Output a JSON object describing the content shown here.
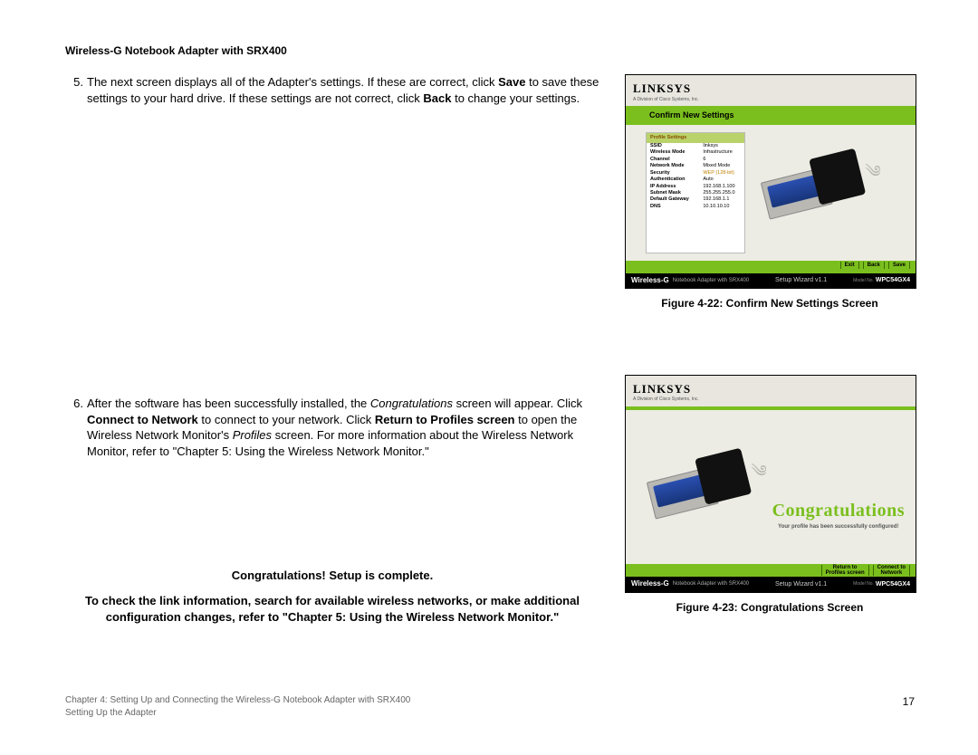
{
  "header": "Wireless-G Notebook Adapter with SRX400",
  "steps": {
    "s5": {
      "num": "5.",
      "pre": "The next screen displays all of the Adapter's settings. If these are correct, click ",
      "b1": "Save",
      "mid": " to save these settings to your hard drive. If these settings are not correct, click ",
      "b2": "Back",
      "post": " to change your settings."
    },
    "s6": {
      "num": "6.",
      "pre": "After the software has been successfully installed, the ",
      "i1": "Congratulations",
      "m1": " screen will appear. Click ",
      "b1": "Connect to Network",
      "m2": " to connect to your network. Click ",
      "b2": "Return to Profiles screen",
      "m3": " to open the Wireless Network Monitor's ",
      "i2": "Profiles",
      "m4": " screen. For more information about the Wireless Network Monitor, refer to \"Chapter 5: Using the Wireless Network Monitor.\""
    }
  },
  "congrats_block": {
    "line1": "Congratulations! Setup is complete.",
    "line2": "To check the link information, search for available wireless networks, or make additional configuration changes, refer to \"Chapter 5: Using the Wireless Network Monitor.\""
  },
  "figure1": {
    "logo": "LINKSYS",
    "logo_sub": "A Division of Cisco Systems, Inc.",
    "band": "Confirm New Settings",
    "ps_head": "Profile Settings",
    "rows": [
      [
        "SSID",
        "linksys"
      ],
      [
        "Wireless Mode",
        "Infrastructure"
      ],
      [
        "Channel",
        "6"
      ],
      [
        "Network Mode",
        "Mixed Mode"
      ],
      [
        "Security",
        "WEP (128-bit)"
      ],
      [
        "Authentication",
        "Auto"
      ],
      [
        "IP Address",
        "192.168.1.100"
      ],
      [
        "Subnet Mask",
        "255.255.255.0"
      ],
      [
        "Default Gateway",
        "192.168.1.1"
      ],
      [
        "DNS",
        "10.10.10.10"
      ]
    ],
    "btns": [
      "Exit",
      "Back",
      "Save"
    ],
    "bar_wg": "Wireless-G",
    "bar_desc": "Notebook Adapter with SRX400",
    "bar_mid": "Setup Wizard  v1.1",
    "bar_model_l": "Model No.",
    "bar_model": "WPC54GX4",
    "caption": "Figure 4-22: Confirm New Settings Screen"
  },
  "figure2": {
    "big": "Congratulations",
    "small": "Your profile has been successfully configured!",
    "btns": [
      "Return to\nProfiles screen",
      "Connect to\nNetwork"
    ],
    "caption": "Figure 4-23: Congratulations Screen"
  },
  "footer": {
    "line1": "Chapter 4: Setting Up and Connecting the Wireless-G Notebook Adapter with SRX400",
    "line2": "Setting Up the Adapter",
    "page": "17"
  }
}
